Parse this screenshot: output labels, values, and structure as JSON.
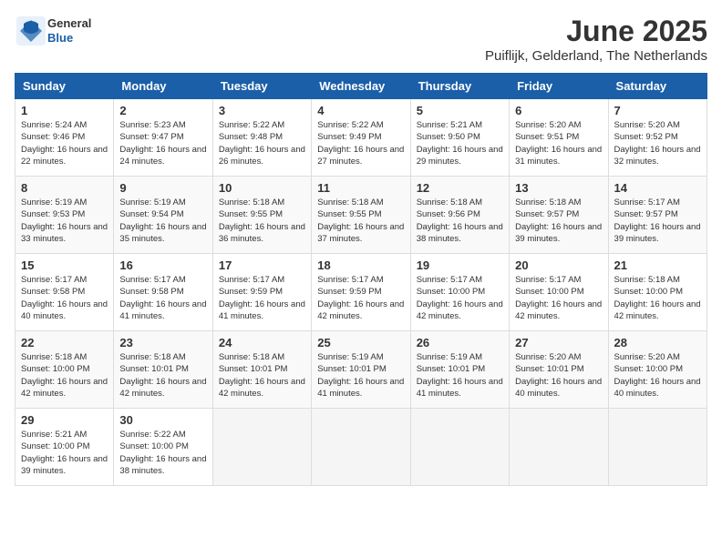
{
  "header": {
    "logo": {
      "general": "General",
      "blue": "Blue"
    },
    "title": "June 2025",
    "subtitle": "Puiflijk, Gelderland, The Netherlands"
  },
  "calendar": {
    "weekdays": [
      "Sunday",
      "Monday",
      "Tuesday",
      "Wednesday",
      "Thursday",
      "Friday",
      "Saturday"
    ],
    "weeks": [
      [
        null,
        null,
        null,
        null,
        null,
        null,
        null
      ]
    ],
    "days": [
      {
        "date": 1,
        "dow": 0,
        "sunrise": "5:24 AM",
        "sunset": "9:46 PM",
        "daylight": "16 hours and 22 minutes."
      },
      {
        "date": 2,
        "dow": 1,
        "sunrise": "5:23 AM",
        "sunset": "9:47 PM",
        "daylight": "16 hours and 24 minutes."
      },
      {
        "date": 3,
        "dow": 2,
        "sunrise": "5:22 AM",
        "sunset": "9:48 PM",
        "daylight": "16 hours and 26 minutes."
      },
      {
        "date": 4,
        "dow": 3,
        "sunrise": "5:22 AM",
        "sunset": "9:49 PM",
        "daylight": "16 hours and 27 minutes."
      },
      {
        "date": 5,
        "dow": 4,
        "sunrise": "5:21 AM",
        "sunset": "9:50 PM",
        "daylight": "16 hours and 29 minutes."
      },
      {
        "date": 6,
        "dow": 5,
        "sunrise": "5:20 AM",
        "sunset": "9:51 PM",
        "daylight": "16 hours and 31 minutes."
      },
      {
        "date": 7,
        "dow": 6,
        "sunrise": "5:20 AM",
        "sunset": "9:52 PM",
        "daylight": "16 hours and 32 minutes."
      },
      {
        "date": 8,
        "dow": 0,
        "sunrise": "5:19 AM",
        "sunset": "9:53 PM",
        "daylight": "16 hours and 33 minutes."
      },
      {
        "date": 9,
        "dow": 1,
        "sunrise": "5:19 AM",
        "sunset": "9:54 PM",
        "daylight": "16 hours and 35 minutes."
      },
      {
        "date": 10,
        "dow": 2,
        "sunrise": "5:18 AM",
        "sunset": "9:55 PM",
        "daylight": "16 hours and 36 minutes."
      },
      {
        "date": 11,
        "dow": 3,
        "sunrise": "5:18 AM",
        "sunset": "9:55 PM",
        "daylight": "16 hours and 37 minutes."
      },
      {
        "date": 12,
        "dow": 4,
        "sunrise": "5:18 AM",
        "sunset": "9:56 PM",
        "daylight": "16 hours and 38 minutes."
      },
      {
        "date": 13,
        "dow": 5,
        "sunrise": "5:18 AM",
        "sunset": "9:57 PM",
        "daylight": "16 hours and 39 minutes."
      },
      {
        "date": 14,
        "dow": 6,
        "sunrise": "5:17 AM",
        "sunset": "9:57 PM",
        "daylight": "16 hours and 39 minutes."
      },
      {
        "date": 15,
        "dow": 0,
        "sunrise": "5:17 AM",
        "sunset": "9:58 PM",
        "daylight": "16 hours and 40 minutes."
      },
      {
        "date": 16,
        "dow": 1,
        "sunrise": "5:17 AM",
        "sunset": "9:58 PM",
        "daylight": "16 hours and 41 minutes."
      },
      {
        "date": 17,
        "dow": 2,
        "sunrise": "5:17 AM",
        "sunset": "9:59 PM",
        "daylight": "16 hours and 41 minutes."
      },
      {
        "date": 18,
        "dow": 3,
        "sunrise": "5:17 AM",
        "sunset": "9:59 PM",
        "daylight": "16 hours and 42 minutes."
      },
      {
        "date": 19,
        "dow": 4,
        "sunrise": "5:17 AM",
        "sunset": "10:00 PM",
        "daylight": "16 hours and 42 minutes."
      },
      {
        "date": 20,
        "dow": 5,
        "sunrise": "5:17 AM",
        "sunset": "10:00 PM",
        "daylight": "16 hours and 42 minutes."
      },
      {
        "date": 21,
        "dow": 6,
        "sunrise": "5:18 AM",
        "sunset": "10:00 PM",
        "daylight": "16 hours and 42 minutes."
      },
      {
        "date": 22,
        "dow": 0,
        "sunrise": "5:18 AM",
        "sunset": "10:00 PM",
        "daylight": "16 hours and 42 minutes."
      },
      {
        "date": 23,
        "dow": 1,
        "sunrise": "5:18 AM",
        "sunset": "10:01 PM",
        "daylight": "16 hours and 42 minutes."
      },
      {
        "date": 24,
        "dow": 2,
        "sunrise": "5:18 AM",
        "sunset": "10:01 PM",
        "daylight": "16 hours and 42 minutes."
      },
      {
        "date": 25,
        "dow": 3,
        "sunrise": "5:19 AM",
        "sunset": "10:01 PM",
        "daylight": "16 hours and 41 minutes."
      },
      {
        "date": 26,
        "dow": 4,
        "sunrise": "5:19 AM",
        "sunset": "10:01 PM",
        "daylight": "16 hours and 41 minutes."
      },
      {
        "date": 27,
        "dow": 5,
        "sunrise": "5:20 AM",
        "sunset": "10:01 PM",
        "daylight": "16 hours and 40 minutes."
      },
      {
        "date": 28,
        "dow": 6,
        "sunrise": "5:20 AM",
        "sunset": "10:00 PM",
        "daylight": "16 hours and 40 minutes."
      },
      {
        "date": 29,
        "dow": 0,
        "sunrise": "5:21 AM",
        "sunset": "10:00 PM",
        "daylight": "16 hours and 39 minutes."
      },
      {
        "date": 30,
        "dow": 1,
        "sunrise": "5:22 AM",
        "sunset": "10:00 PM",
        "daylight": "16 hours and 38 minutes."
      }
    ]
  }
}
